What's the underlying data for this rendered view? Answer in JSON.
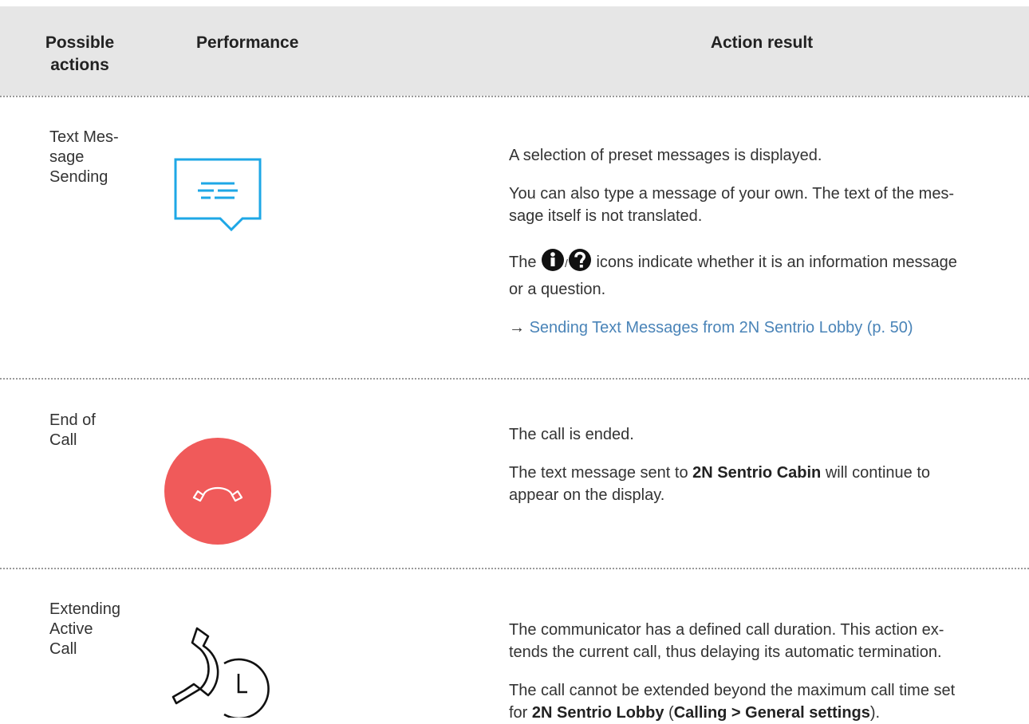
{
  "header": {
    "col1": "Possible actions",
    "col1_line1": "Possible",
    "col1_line2": "actions",
    "col2": "Performance",
    "col3": "Action result"
  },
  "rows": [
    {
      "action_lines": [
        "Text Mes-",
        "sage",
        "Sending"
      ],
      "icon": "message-bubble-icon",
      "p1": "A selection of preset messages is displayed.",
      "p2_line1": "You can also type a message of your own. The text of the mes-",
      "p2_line2": "sage itself is not translated.",
      "p3_pre": "The",
      "p3_sep": "/",
      "p3_post": " icons indicate whether it is an information message",
      "p3_line2": "or a question.",
      "link_arrow": "→",
      "link_text": "Sending Text Messages from 2N Sentrio Lobby (p. 50)"
    },
    {
      "action_lines": [
        "End of",
        "Call"
      ],
      "icon": "hang-up-icon",
      "p1": "The call is ended.",
      "p2_pre": "The text message sent to ",
      "p2_bold": "2N Sentrio Cabin",
      "p2_post": " will continue to",
      "p2_line2": "appear on the display."
    },
    {
      "action_lines": [
        "Extending",
        "Active",
        "Call"
      ],
      "icon": "extend-call-clock-icon",
      "p1_line1": "The communicator has a defined call duration. This action ex-",
      "p1_line2": "tends the current call, thus delaying its automatic termination.",
      "p2_line1": "The call cannot be extended beyond the maximum call time set",
      "p2_pre": "for ",
      "p2_bold1": "2N Sentrio Lobby",
      "p2_mid": " (",
      "p2_bold2": "Calling > General settings",
      "p2_post": ")."
    }
  ],
  "colors": {
    "header_bg": "#e6e6e6",
    "accent_blue": "#1ea7e6",
    "hangup_red": "#f05a5a",
    "link": "#4a84b8"
  }
}
